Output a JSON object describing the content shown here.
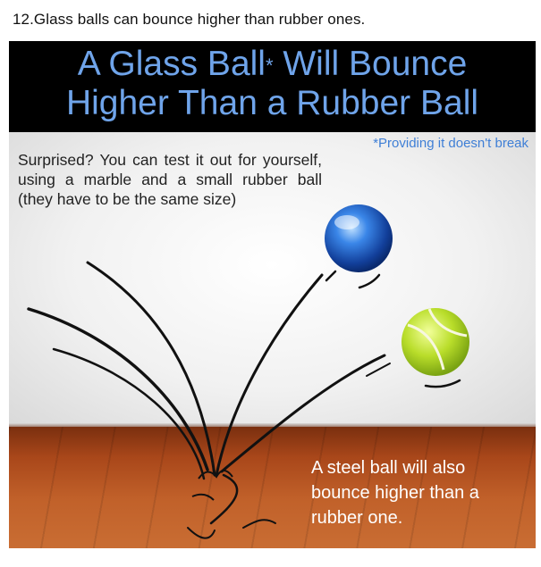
{
  "caption": "12.Glass balls can bounce higher than rubber ones.",
  "poster": {
    "headline_line1_pre": "A Glass Ball",
    "headline_star": "*",
    "headline_line1_post": " Will Bounce",
    "headline_line2": "Higher Than a Rubber Ball",
    "footnote": "*Providing it doesn't break",
    "intro": "Surprised? You can test it out for yourself, using a marble and a small rubber ball (they have to be the same size)",
    "steel_note": "A steel ball will also bounce higher than a rubber one."
  },
  "colors": {
    "headline": "#6fa4ea",
    "banner_bg": "#000000",
    "footnote": "#3f7fd6",
    "floor": "#b5531f",
    "glass_ball": "#2a6fd6",
    "rubber_ball": "#b9dd2a"
  }
}
